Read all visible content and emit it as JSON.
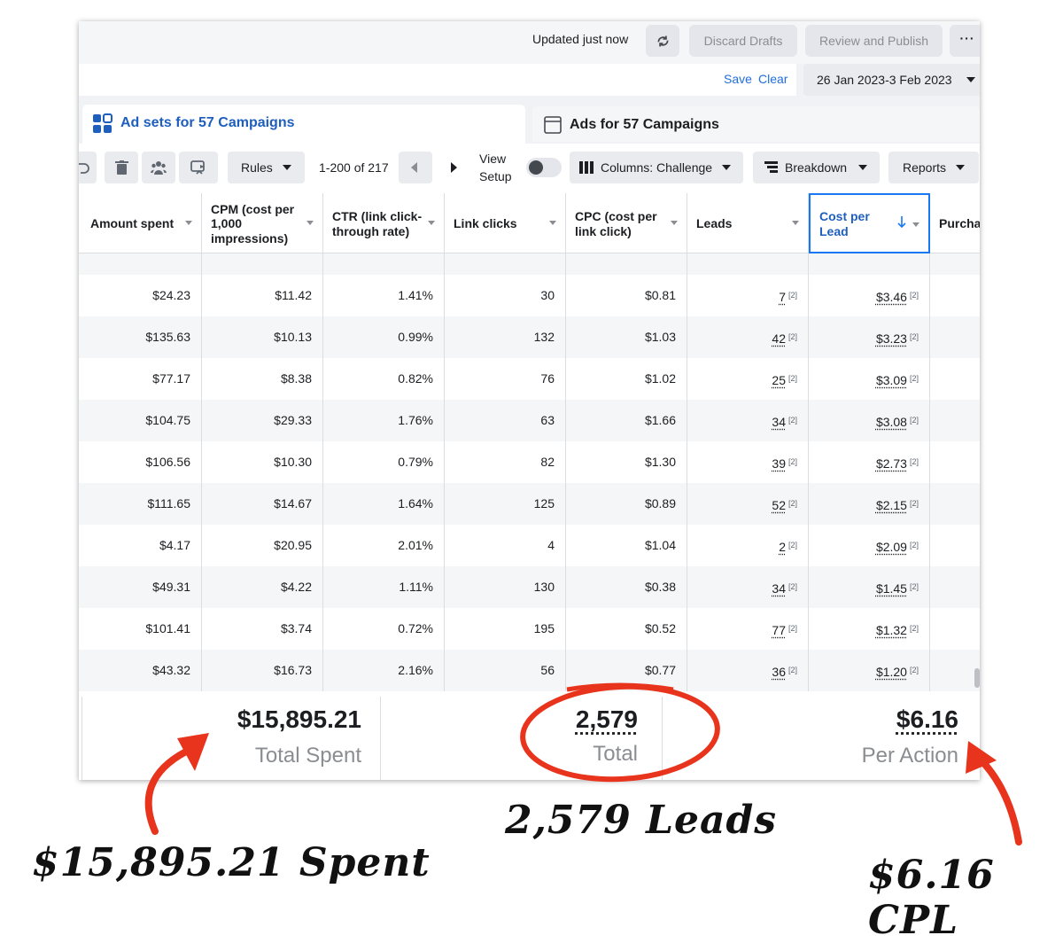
{
  "topbar": {
    "updated": "Updated just now",
    "discard": "Discard Drafts",
    "publish": "Review and Publish",
    "more": "···"
  },
  "daterow": {
    "save": "Save",
    "clear": "Clear",
    "date_range": "26 Jan 2023-3 Feb 2023"
  },
  "tabs": {
    "adsets": "Ad sets for 57 Campaigns",
    "ads": "Ads for 57 Campaigns"
  },
  "toolbar": {
    "rules": "Rules",
    "pagination": "1-200 of 217",
    "view_setup_1": "View",
    "view_setup_2": "Setup",
    "columns": "Columns: Challenge",
    "breakdown": "Breakdown",
    "reports": "Reports"
  },
  "columns": {
    "amount_spent": "Amount spent",
    "cpm_1": "CPM (cost per",
    "cpm_2": "1,000",
    "cpm_3": "impressions)",
    "ctr_1": "CTR (link click-",
    "ctr_2": "through rate)",
    "link_clicks": "Link clicks",
    "cpc_1": "CPC (cost per",
    "cpc_2": "link click)",
    "leads": "Leads",
    "cpl_1": "Cost per",
    "cpl_2": "Lead",
    "purchases": "Purchas"
  },
  "rows": [
    {
      "amount": "$24.23",
      "cpm": "$11.42",
      "ctr": "1.41%",
      "clicks": "30",
      "cpc": "$0.81",
      "leads": "7",
      "cpl": "$3.46",
      "note": "[2]"
    },
    {
      "amount": "$135.63",
      "cpm": "$10.13",
      "ctr": "0.99%",
      "clicks": "132",
      "cpc": "$1.03",
      "leads": "42",
      "cpl": "$3.23",
      "note": "[2]"
    },
    {
      "amount": "$77.17",
      "cpm": "$8.38",
      "ctr": "0.82%",
      "clicks": "76",
      "cpc": "$1.02",
      "leads": "25",
      "cpl": "$3.09",
      "note": "[2]"
    },
    {
      "amount": "$104.75",
      "cpm": "$29.33",
      "ctr": "1.76%",
      "clicks": "63",
      "cpc": "$1.66",
      "leads": "34",
      "cpl": "$3.08",
      "note": "[2]"
    },
    {
      "amount": "$106.56",
      "cpm": "$10.30",
      "ctr": "0.79%",
      "clicks": "82",
      "cpc": "$1.30",
      "leads": "39",
      "cpl": "$2.73",
      "note": "[2]"
    },
    {
      "amount": "$111.65",
      "cpm": "$14.67",
      "ctr": "1.64%",
      "clicks": "125",
      "cpc": "$0.89",
      "leads": "52",
      "cpl": "$2.15",
      "note": "[2]"
    },
    {
      "amount": "$4.17",
      "cpm": "$20.95",
      "ctr": "2.01%",
      "clicks": "4",
      "cpc": "$1.04",
      "leads": "2",
      "cpl": "$2.09",
      "note": "[2]"
    },
    {
      "amount": "$49.31",
      "cpm": "$4.22",
      "ctr": "1.11%",
      "clicks": "130",
      "cpc": "$0.38",
      "leads": "34",
      "cpl": "$1.45",
      "note": "[2]"
    },
    {
      "amount": "$101.41",
      "cpm": "$3.74",
      "ctr": "0.72%",
      "clicks": "195",
      "cpc": "$0.52",
      "leads": "77",
      "cpl": "$1.32",
      "note": "[2]"
    },
    {
      "amount": "$43.32",
      "cpm": "$16.73",
      "ctr": "2.16%",
      "clicks": "56",
      "cpc": "$0.77",
      "leads": "36",
      "cpl": "$1.20",
      "note": "[2]"
    }
  ],
  "totals": {
    "spent_value": "$15,895.21",
    "spent_label": "Total Spent",
    "leads_value": "2,579",
    "leads_label": "Total",
    "cpl_value": "$6.16",
    "cpl_label": "Per Action"
  },
  "annotations": {
    "spent": "$15,895.21 Spent",
    "leads": "2,579 Leads",
    "cpl": "$6.16 CPL",
    "color": "#e8341c"
  },
  "colors": {
    "accent": "#1e5ebd",
    "active_border": "#1877f2",
    "link": "#216fdb"
  }
}
